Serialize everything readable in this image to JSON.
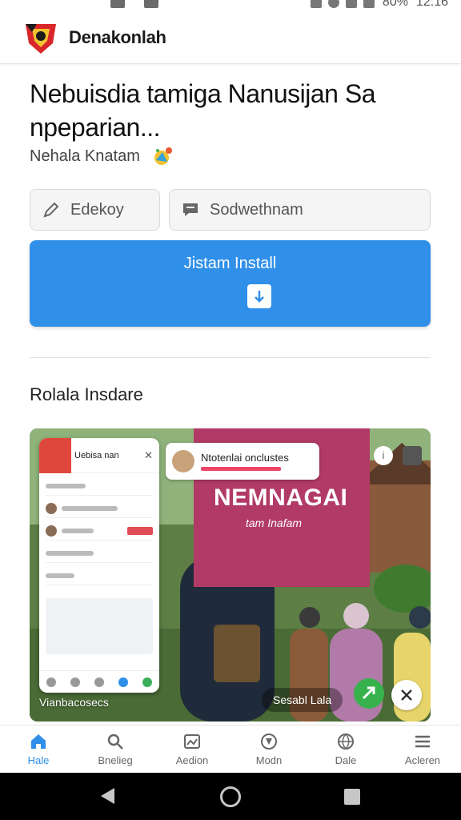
{
  "status_bar": {
    "battery": "80%",
    "time": "12:16"
  },
  "header": {
    "title": "Denakonlah"
  },
  "headline": {
    "title": "Nebuisdia tamiga Nanusijan Sa npeparian...",
    "subtitle": "Nehala Knatam"
  },
  "actions": {
    "edit_label": "Edekoy",
    "comment_label": "Sodwethnam",
    "install_label": "Jistam Install"
  },
  "section": {
    "title": "Rolala Insdare"
  },
  "hero": {
    "banner_title": "NEMNAGAI",
    "banner_subtitle": "tam Inafam",
    "notification_title": "Ntotenlai onclustes",
    "phone_header": "Uebisa nan",
    "caption_left": "Vianbacosecs",
    "caption_right": "Sesabl Lala"
  },
  "bottom_nav": {
    "items": [
      {
        "label": "Hale",
        "icon": "home-icon",
        "active": true
      },
      {
        "label": "Bnelieg",
        "icon": "search-icon",
        "active": false
      },
      {
        "label": "Aedion",
        "icon": "media-icon",
        "active": false
      },
      {
        "label": "Modn",
        "icon": "compass-icon",
        "active": false
      },
      {
        "label": "Dale",
        "icon": "globe-icon",
        "active": false
      },
      {
        "label": "Acleren",
        "icon": "menu-icon",
        "active": false
      }
    ]
  },
  "colors": {
    "accent": "#2f8fe9",
    "banner": "#b23a66",
    "share": "#37b24d"
  }
}
